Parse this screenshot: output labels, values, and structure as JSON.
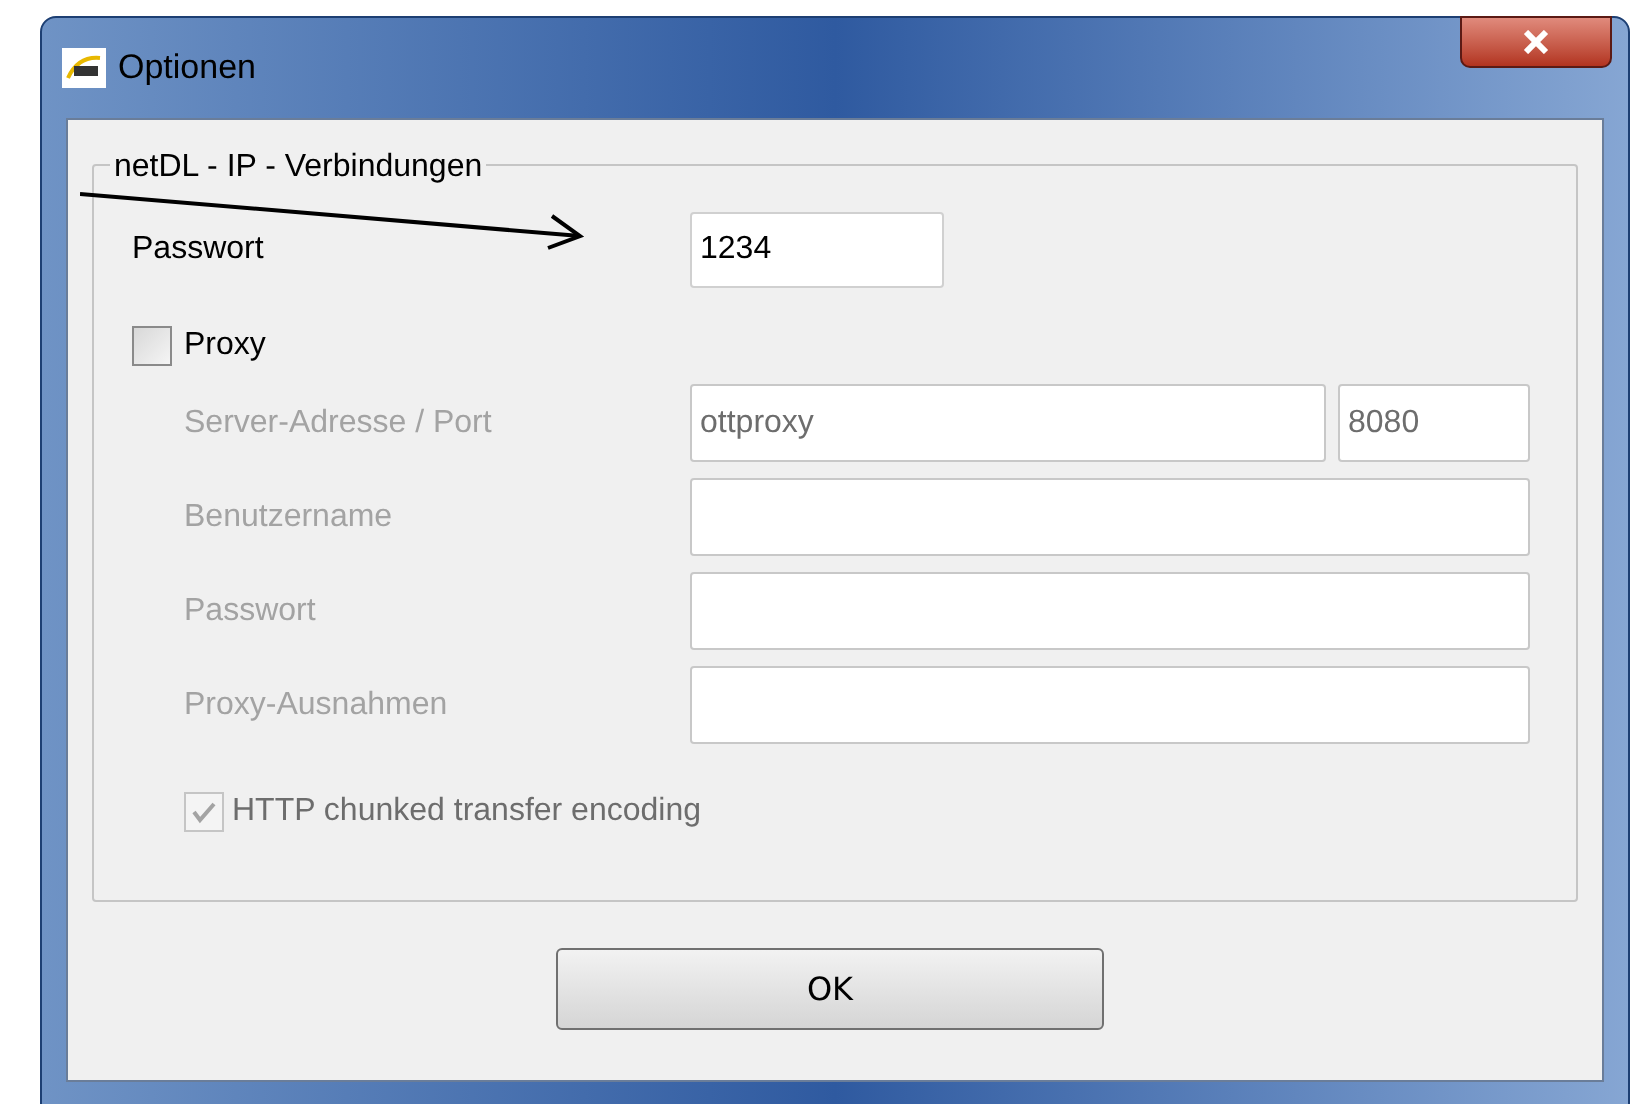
{
  "window": {
    "title": "Optionen"
  },
  "group": {
    "title": "netDL - IP - Verbindungen"
  },
  "password": {
    "label": "Passwort",
    "value": "1234"
  },
  "proxy": {
    "label": "Proxy",
    "checked": false,
    "fields": [
      {
        "label": "Server-Adresse / Port",
        "value": "ottproxy",
        "port": "8080"
      },
      {
        "label": "Benutzername"
      },
      {
        "label": "Passwort"
      },
      {
        "label": "Proxy-Ausnahmen"
      }
    ],
    "chunked": {
      "label": "HTTP chunked transfer encoding",
      "checked": true
    }
  },
  "buttons": [
    {
      "label": "OK"
    }
  ]
}
